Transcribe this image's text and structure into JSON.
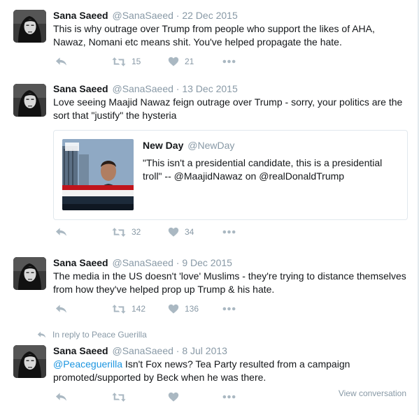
{
  "tweets": [
    {
      "name": "Sana Saeed",
      "handle": "@SanaSaeed",
      "sep": "·",
      "date": "22 Dec 2015",
      "text": "This is why outrage over Trump from people who support the likes of AHA, Nawaz, Nomani etc means shit. You've helped propagate the hate.",
      "retweets": "15",
      "likes": "21"
    },
    {
      "name": "Sana Saeed",
      "handle": "@SanaSaeed",
      "sep": "·",
      "date": "13 Dec 2015",
      "text": "Love seeing Maajid Nawaz feign outrage over Trump - sorry, your politics are the sort that \"justify\" the hysteria",
      "retweets": "32",
      "likes": "34",
      "quote": {
        "name": "New Day",
        "handle": "@NewDay",
        "text": "\"This isn't a presidential candidate, this is a presidential troll\" -- @MaajidNawaz on @realDonaldTrump"
      }
    },
    {
      "name": "Sana Saeed",
      "handle": "@SanaSaeed",
      "sep": "·",
      "date": "9 Dec 2015",
      "text": "The media in the US doesn't 'love' Muslims - they're trying to distance themselves from how they've helped prop up Trump & his hate.",
      "retweets": "142",
      "likes": "136"
    },
    {
      "reply_to": "In reply to Peace Guerilla",
      "name": "Sana Saeed",
      "handle": "@SanaSaeed",
      "sep": "·",
      "date": "8 Jul 2013",
      "mention": "@Peaceguerilla",
      "text": " Isn't Fox news? Tea Party resulted from a campaign promoted/supported by Beck when he was there.",
      "view_conversation": "View conversation"
    }
  ],
  "colors": {
    "link": "#1b95e0",
    "muted": "#8899a6",
    "icon": "#aab8c2",
    "border": "#e1e8ed"
  },
  "icons": [
    "reply-icon",
    "retweet-icon",
    "like-icon",
    "more-icon"
  ]
}
